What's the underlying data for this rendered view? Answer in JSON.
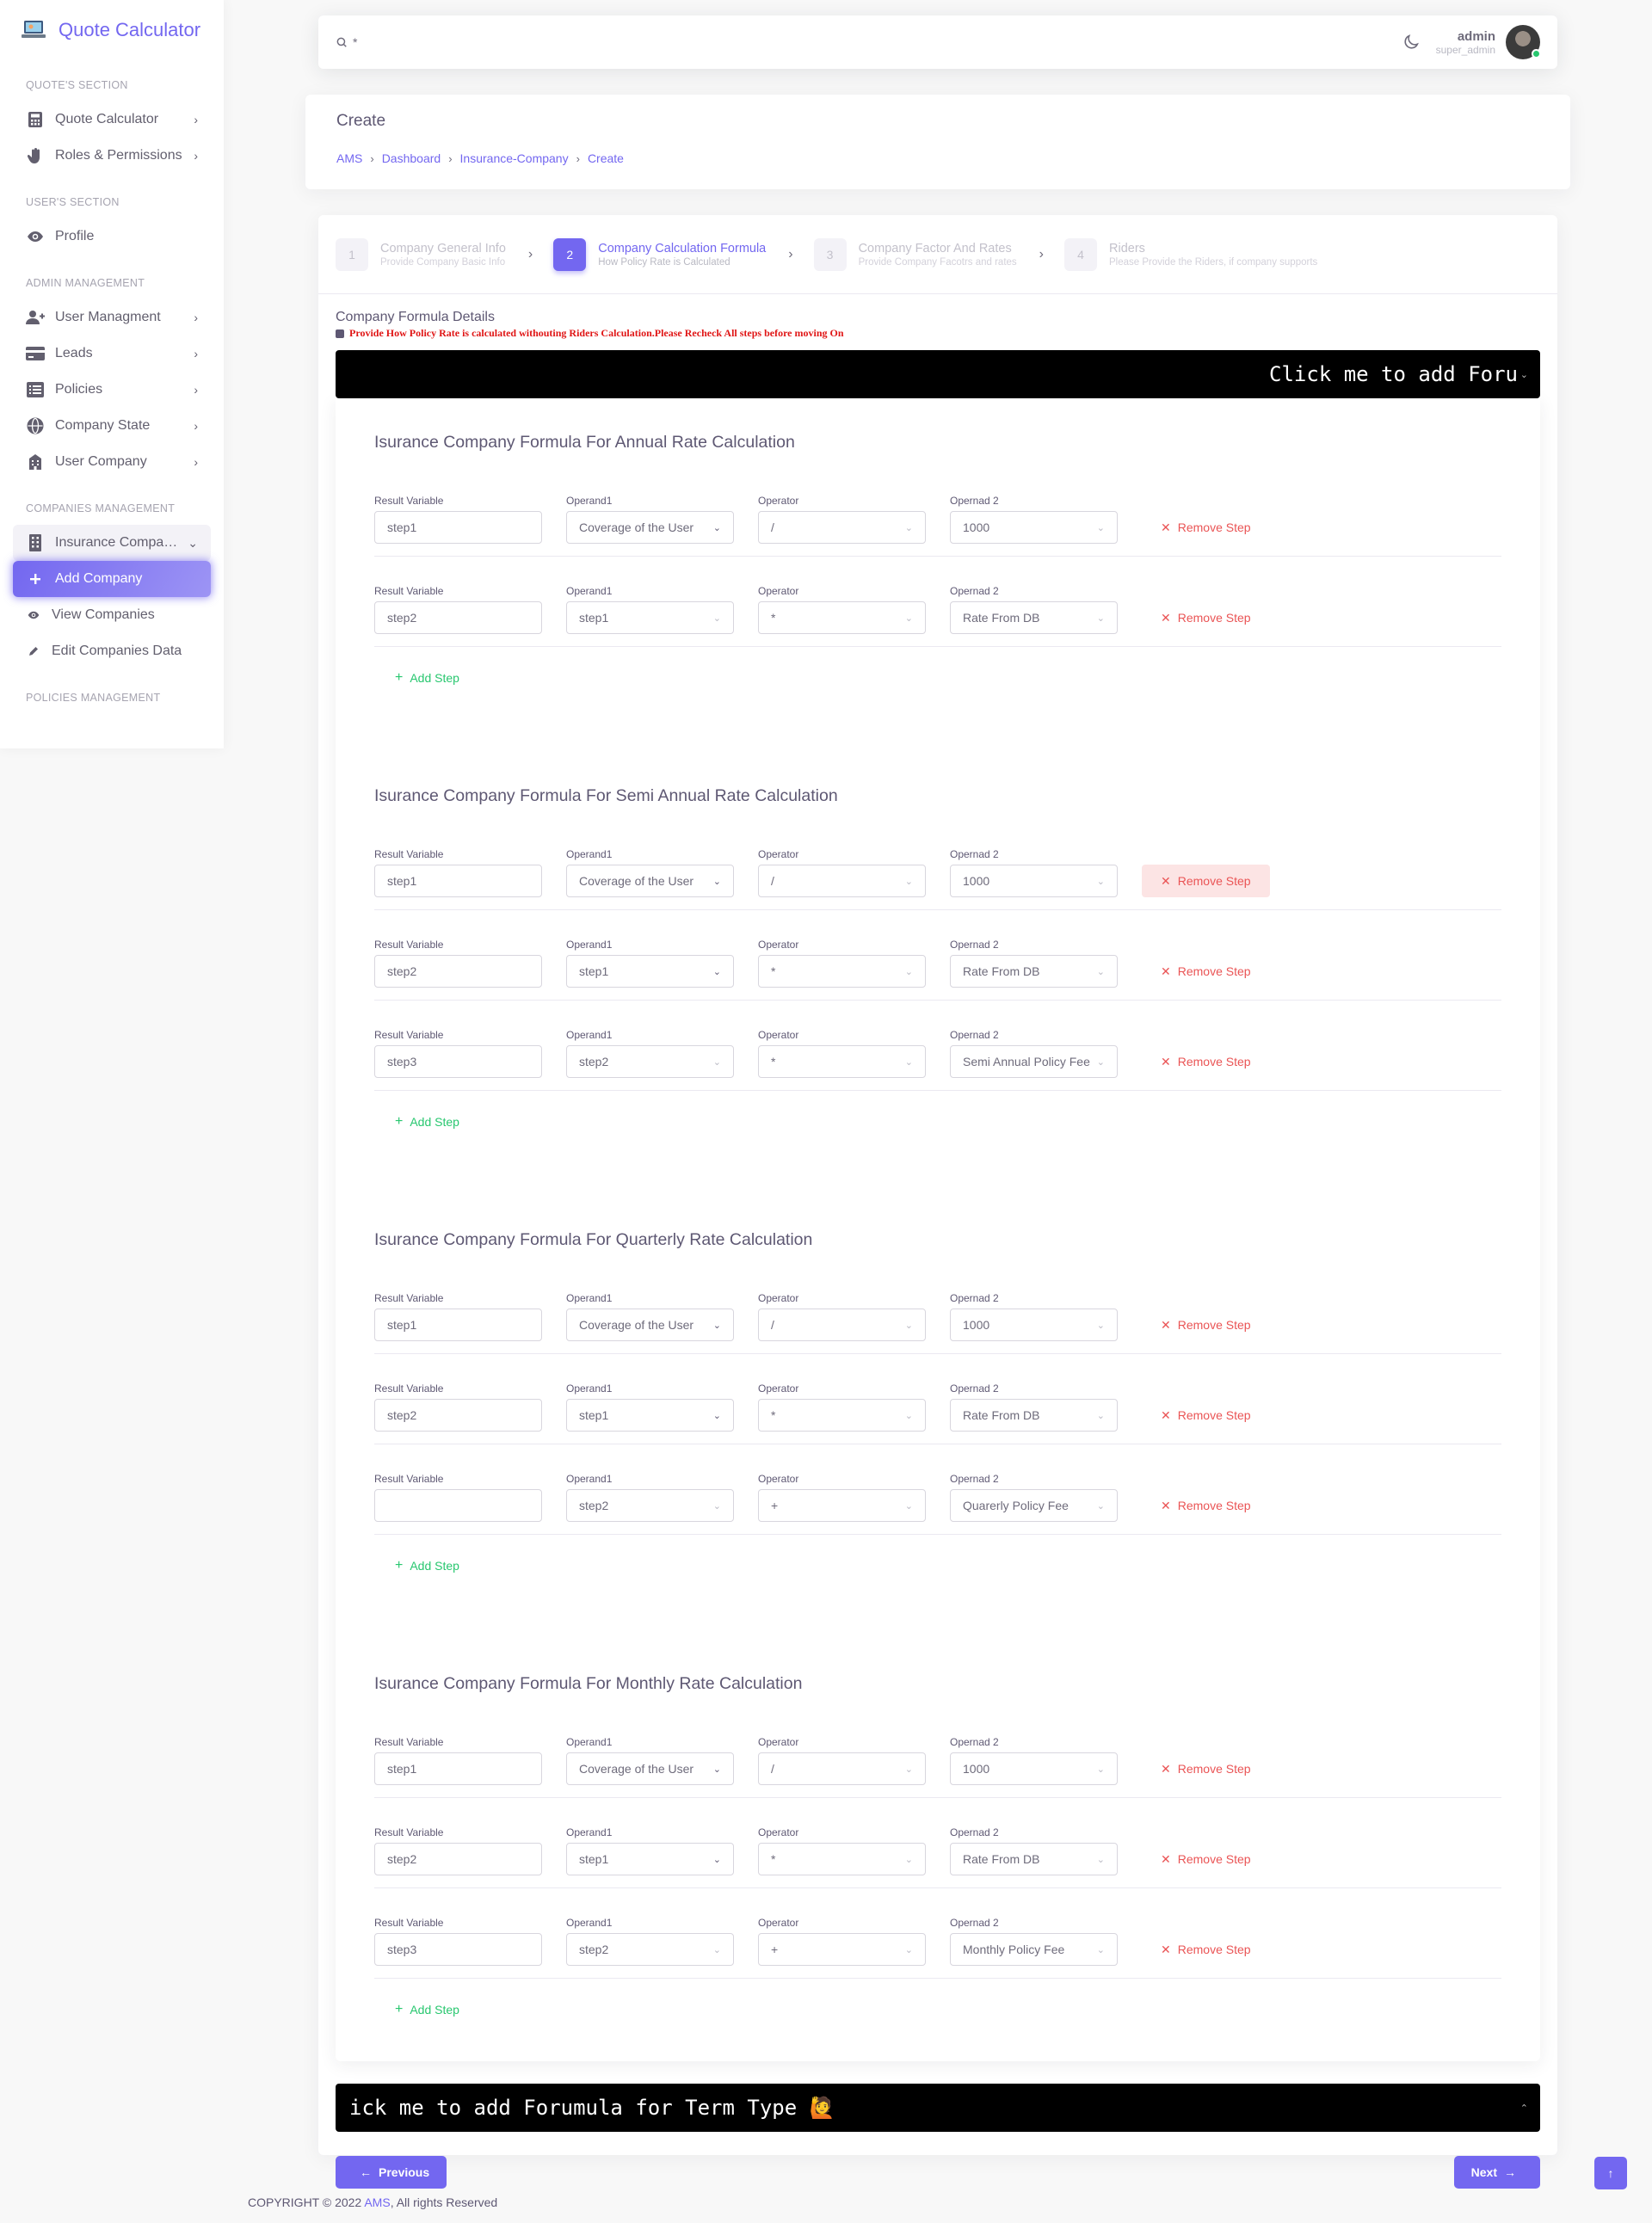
{
  "brand": {
    "name": "Quote Calculator",
    "logo_icon": "laptop-icon"
  },
  "sidebar": {
    "sections": [
      {
        "header": "QUOTE'S SECTION",
        "items": [
          {
            "label": "Quote Calculator",
            "icon": "calculator-icon",
            "chevron": true
          },
          {
            "label": "Roles & Permissions",
            "icon": "hand-icon",
            "chevron": true
          }
        ]
      },
      {
        "header": "USER'S SECTION",
        "items": [
          {
            "label": "Profile",
            "icon": "eye-icon",
            "chevron": false
          }
        ]
      },
      {
        "header": "ADMIN MANAGEMENT",
        "items": [
          {
            "label": "User Managment",
            "icon": "user-plus-icon",
            "chevron": true
          },
          {
            "label": "Leads",
            "icon": "credit-card-icon",
            "chevron": true
          },
          {
            "label": "Policies",
            "icon": "list-icon",
            "chevron": true
          },
          {
            "label": "Company State",
            "icon": "globe-icon",
            "chevron": true
          },
          {
            "label": "User Company",
            "icon": "building-icon",
            "chevron": true
          }
        ]
      },
      {
        "header": "COMPANIES MANAGEMENT",
        "items": [
          {
            "label": "Insurance Companies",
            "icon": "office-icon",
            "chevron": true,
            "state": "open"
          },
          {
            "label": "Add Company",
            "icon": "plus-icon",
            "state": "active"
          },
          {
            "label": "View Companies",
            "icon": "eye-icon",
            "sub": true
          },
          {
            "label": "Edit Companies Data",
            "icon": "pencil-icon",
            "sub": true
          }
        ]
      },
      {
        "header": "POLICIES MANAGEMENT",
        "items": []
      }
    ]
  },
  "topbar": {
    "search_text": "*",
    "user_name": "admin",
    "user_role": "super_admin",
    "status_color": "#28c76f"
  },
  "header": {
    "title": "Create",
    "breadcrumb": [
      "AMS",
      "Dashboard",
      "Insurance-Company",
      "Create"
    ]
  },
  "stepper": [
    {
      "num": "1",
      "title": "Company General Info",
      "subtitle": "Provide Company Basic Info",
      "active": false
    },
    {
      "num": "2",
      "title": "Company Calculation Formula",
      "subtitle": "How Policy Rate is Calculated",
      "active": true
    },
    {
      "num": "3",
      "title": "Company Factor And Rates",
      "subtitle": "Provide Company Facotrs and rates",
      "active": false
    },
    {
      "num": "4",
      "title": "Riders",
      "subtitle": "Please Provide the Riders, if company supports",
      "active": false
    }
  ],
  "form": {
    "title": "Company Formula Details",
    "note": "Provide How Policy Rate is calculated withouting Riders Calculation.Please Recheck All steps before moving On",
    "top_bar_text": "Click me to add Foru",
    "bottom_bar_text": "ick me to add Forumula for Term Type 🙋",
    "labels": {
      "result": "Result Variable",
      "op1": "Operand1",
      "operator": "Operator",
      "op2": "Opernad 2"
    },
    "remove_label": "Remove Step",
    "add_label": "Add Step",
    "sections": [
      {
        "title": "Isurance Company Formula For Annual Rate Calculation",
        "rows": [
          {
            "result": "step1",
            "op1": "Coverage of the User",
            "operator": "/",
            "op2": "1000"
          },
          {
            "result": "step2",
            "op1": "step1",
            "operator": "*",
            "op2": "Rate From DB"
          }
        ]
      },
      {
        "title": "Isurance Company Formula For Semi Annual Rate Calculation",
        "rows": [
          {
            "result": "step1",
            "op1": "Coverage of the User",
            "operator": "/",
            "op2": "1000",
            "hover": true
          },
          {
            "result": "step2",
            "op1": "step1",
            "operator": "*",
            "op2": "Rate From DB"
          },
          {
            "result": "step3",
            "op1": "step2",
            "operator": "*",
            "op2": "Semi Annual Policy Fee"
          }
        ]
      },
      {
        "title": "Isurance Company Formula For Quarterly Rate Calculation",
        "rows": [
          {
            "result": "step1",
            "op1": "Coverage of the User",
            "operator": "/",
            "op2": "1000"
          },
          {
            "result": "step2",
            "op1": "step1",
            "operator": "*",
            "op2": "Rate From DB"
          },
          {
            "result": "",
            "op1": "step2",
            "operator": "+",
            "op2": "Quarerly Policy Fee"
          }
        ]
      },
      {
        "title": "Isurance Company Formula For Monthly Rate Calculation",
        "rows": [
          {
            "result": "step1",
            "op1": "Coverage of the User",
            "operator": "/",
            "op2": "1000"
          },
          {
            "result": "step2",
            "op1": "step1",
            "operator": "*",
            "op2": "Rate From DB"
          },
          {
            "result": "step3",
            "op1": "step2",
            "operator": "+",
            "op2": "Monthly Policy Fee"
          }
        ]
      }
    ]
  },
  "buttons": {
    "previous": "Previous",
    "next": "Next"
  },
  "footer": {
    "prefix": "COPYRIGHT © 2022 ",
    "brand": "AMS",
    "suffix": ", All rights Reserved"
  },
  "colors": {
    "primary": "#7367f0",
    "danger": "#ea5455",
    "success": "#28c76f"
  }
}
